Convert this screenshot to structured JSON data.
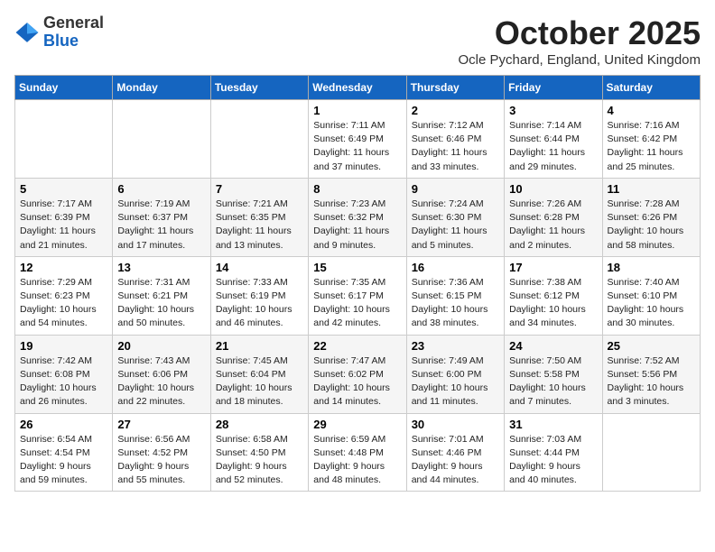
{
  "header": {
    "logo_line1": "General",
    "logo_line2": "Blue",
    "month": "October 2025",
    "location": "Ocle Pychard, England, United Kingdom"
  },
  "days_of_week": [
    "Sunday",
    "Monday",
    "Tuesday",
    "Wednesday",
    "Thursday",
    "Friday",
    "Saturday"
  ],
  "weeks": [
    [
      {
        "day": "",
        "info": ""
      },
      {
        "day": "",
        "info": ""
      },
      {
        "day": "",
        "info": ""
      },
      {
        "day": "1",
        "info": "Sunrise: 7:11 AM\nSunset: 6:49 PM\nDaylight: 11 hours\nand 37 minutes."
      },
      {
        "day": "2",
        "info": "Sunrise: 7:12 AM\nSunset: 6:46 PM\nDaylight: 11 hours\nand 33 minutes."
      },
      {
        "day": "3",
        "info": "Sunrise: 7:14 AM\nSunset: 6:44 PM\nDaylight: 11 hours\nand 29 minutes."
      },
      {
        "day": "4",
        "info": "Sunrise: 7:16 AM\nSunset: 6:42 PM\nDaylight: 11 hours\nand 25 minutes."
      }
    ],
    [
      {
        "day": "5",
        "info": "Sunrise: 7:17 AM\nSunset: 6:39 PM\nDaylight: 11 hours\nand 21 minutes."
      },
      {
        "day": "6",
        "info": "Sunrise: 7:19 AM\nSunset: 6:37 PM\nDaylight: 11 hours\nand 17 minutes."
      },
      {
        "day": "7",
        "info": "Sunrise: 7:21 AM\nSunset: 6:35 PM\nDaylight: 11 hours\nand 13 minutes."
      },
      {
        "day": "8",
        "info": "Sunrise: 7:23 AM\nSunset: 6:32 PM\nDaylight: 11 hours\nand 9 minutes."
      },
      {
        "day": "9",
        "info": "Sunrise: 7:24 AM\nSunset: 6:30 PM\nDaylight: 11 hours\nand 5 minutes."
      },
      {
        "day": "10",
        "info": "Sunrise: 7:26 AM\nSunset: 6:28 PM\nDaylight: 11 hours\nand 2 minutes."
      },
      {
        "day": "11",
        "info": "Sunrise: 7:28 AM\nSunset: 6:26 PM\nDaylight: 10 hours\nand 58 minutes."
      }
    ],
    [
      {
        "day": "12",
        "info": "Sunrise: 7:29 AM\nSunset: 6:23 PM\nDaylight: 10 hours\nand 54 minutes."
      },
      {
        "day": "13",
        "info": "Sunrise: 7:31 AM\nSunset: 6:21 PM\nDaylight: 10 hours\nand 50 minutes."
      },
      {
        "day": "14",
        "info": "Sunrise: 7:33 AM\nSunset: 6:19 PM\nDaylight: 10 hours\nand 46 minutes."
      },
      {
        "day": "15",
        "info": "Sunrise: 7:35 AM\nSunset: 6:17 PM\nDaylight: 10 hours\nand 42 minutes."
      },
      {
        "day": "16",
        "info": "Sunrise: 7:36 AM\nSunset: 6:15 PM\nDaylight: 10 hours\nand 38 minutes."
      },
      {
        "day": "17",
        "info": "Sunrise: 7:38 AM\nSunset: 6:12 PM\nDaylight: 10 hours\nand 34 minutes."
      },
      {
        "day": "18",
        "info": "Sunrise: 7:40 AM\nSunset: 6:10 PM\nDaylight: 10 hours\nand 30 minutes."
      }
    ],
    [
      {
        "day": "19",
        "info": "Sunrise: 7:42 AM\nSunset: 6:08 PM\nDaylight: 10 hours\nand 26 minutes."
      },
      {
        "day": "20",
        "info": "Sunrise: 7:43 AM\nSunset: 6:06 PM\nDaylight: 10 hours\nand 22 minutes."
      },
      {
        "day": "21",
        "info": "Sunrise: 7:45 AM\nSunset: 6:04 PM\nDaylight: 10 hours\nand 18 minutes."
      },
      {
        "day": "22",
        "info": "Sunrise: 7:47 AM\nSunset: 6:02 PM\nDaylight: 10 hours\nand 14 minutes."
      },
      {
        "day": "23",
        "info": "Sunrise: 7:49 AM\nSunset: 6:00 PM\nDaylight: 10 hours\nand 11 minutes."
      },
      {
        "day": "24",
        "info": "Sunrise: 7:50 AM\nSunset: 5:58 PM\nDaylight: 10 hours\nand 7 minutes."
      },
      {
        "day": "25",
        "info": "Sunrise: 7:52 AM\nSunset: 5:56 PM\nDaylight: 10 hours\nand 3 minutes."
      }
    ],
    [
      {
        "day": "26",
        "info": "Sunrise: 6:54 AM\nSunset: 4:54 PM\nDaylight: 9 hours\nand 59 minutes."
      },
      {
        "day": "27",
        "info": "Sunrise: 6:56 AM\nSunset: 4:52 PM\nDaylight: 9 hours\nand 55 minutes."
      },
      {
        "day": "28",
        "info": "Sunrise: 6:58 AM\nSunset: 4:50 PM\nDaylight: 9 hours\nand 52 minutes."
      },
      {
        "day": "29",
        "info": "Sunrise: 6:59 AM\nSunset: 4:48 PM\nDaylight: 9 hours\nand 48 minutes."
      },
      {
        "day": "30",
        "info": "Sunrise: 7:01 AM\nSunset: 4:46 PM\nDaylight: 9 hours\nand 44 minutes."
      },
      {
        "day": "31",
        "info": "Sunrise: 7:03 AM\nSunset: 4:44 PM\nDaylight: 9 hours\nand 40 minutes."
      },
      {
        "day": "",
        "info": ""
      }
    ]
  ]
}
